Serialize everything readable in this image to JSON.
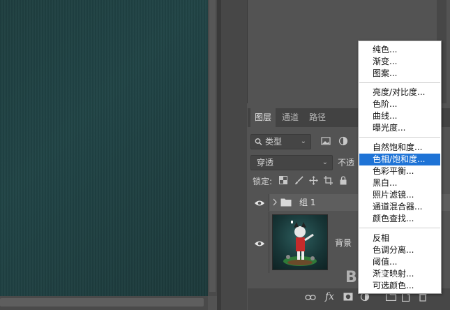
{
  "layers_panel": {
    "tabs": [
      "图层",
      "通道",
      "路径"
    ],
    "filter": {
      "value": "类型"
    },
    "blend_mode": {
      "value": "穿透"
    },
    "opacity_label": "不透",
    "lock_label": "锁定:",
    "layers": [
      {
        "name": "组 1",
        "type": "group"
      },
      {
        "name": "背景",
        "type": "image"
      }
    ],
    "footer_icons": [
      "link-icon",
      "fx-icon",
      "mask-icon",
      "adjustment-icon",
      "folder-icon",
      "new-layer-icon",
      "trash-icon"
    ],
    "fx_label": "fx"
  },
  "adjustment_menu": {
    "items": [
      "纯色...",
      "渐变...",
      "图案...",
      "亮度/对比度...",
      "色阶...",
      "曲线...",
      "曝光度...",
      "自然饱和度...",
      "色相/饱和度...",
      "色彩平衡...",
      "黑白...",
      "照片滤镜...",
      "通道混合器...",
      "颜色查找...",
      "反相",
      "色调分离...",
      "阈值...",
      "渐变映射...",
      "可选颜色..."
    ],
    "highlighted": "色相/饱和度...",
    "highlight_color": "#1e73d6"
  },
  "watermark": "Baidu"
}
